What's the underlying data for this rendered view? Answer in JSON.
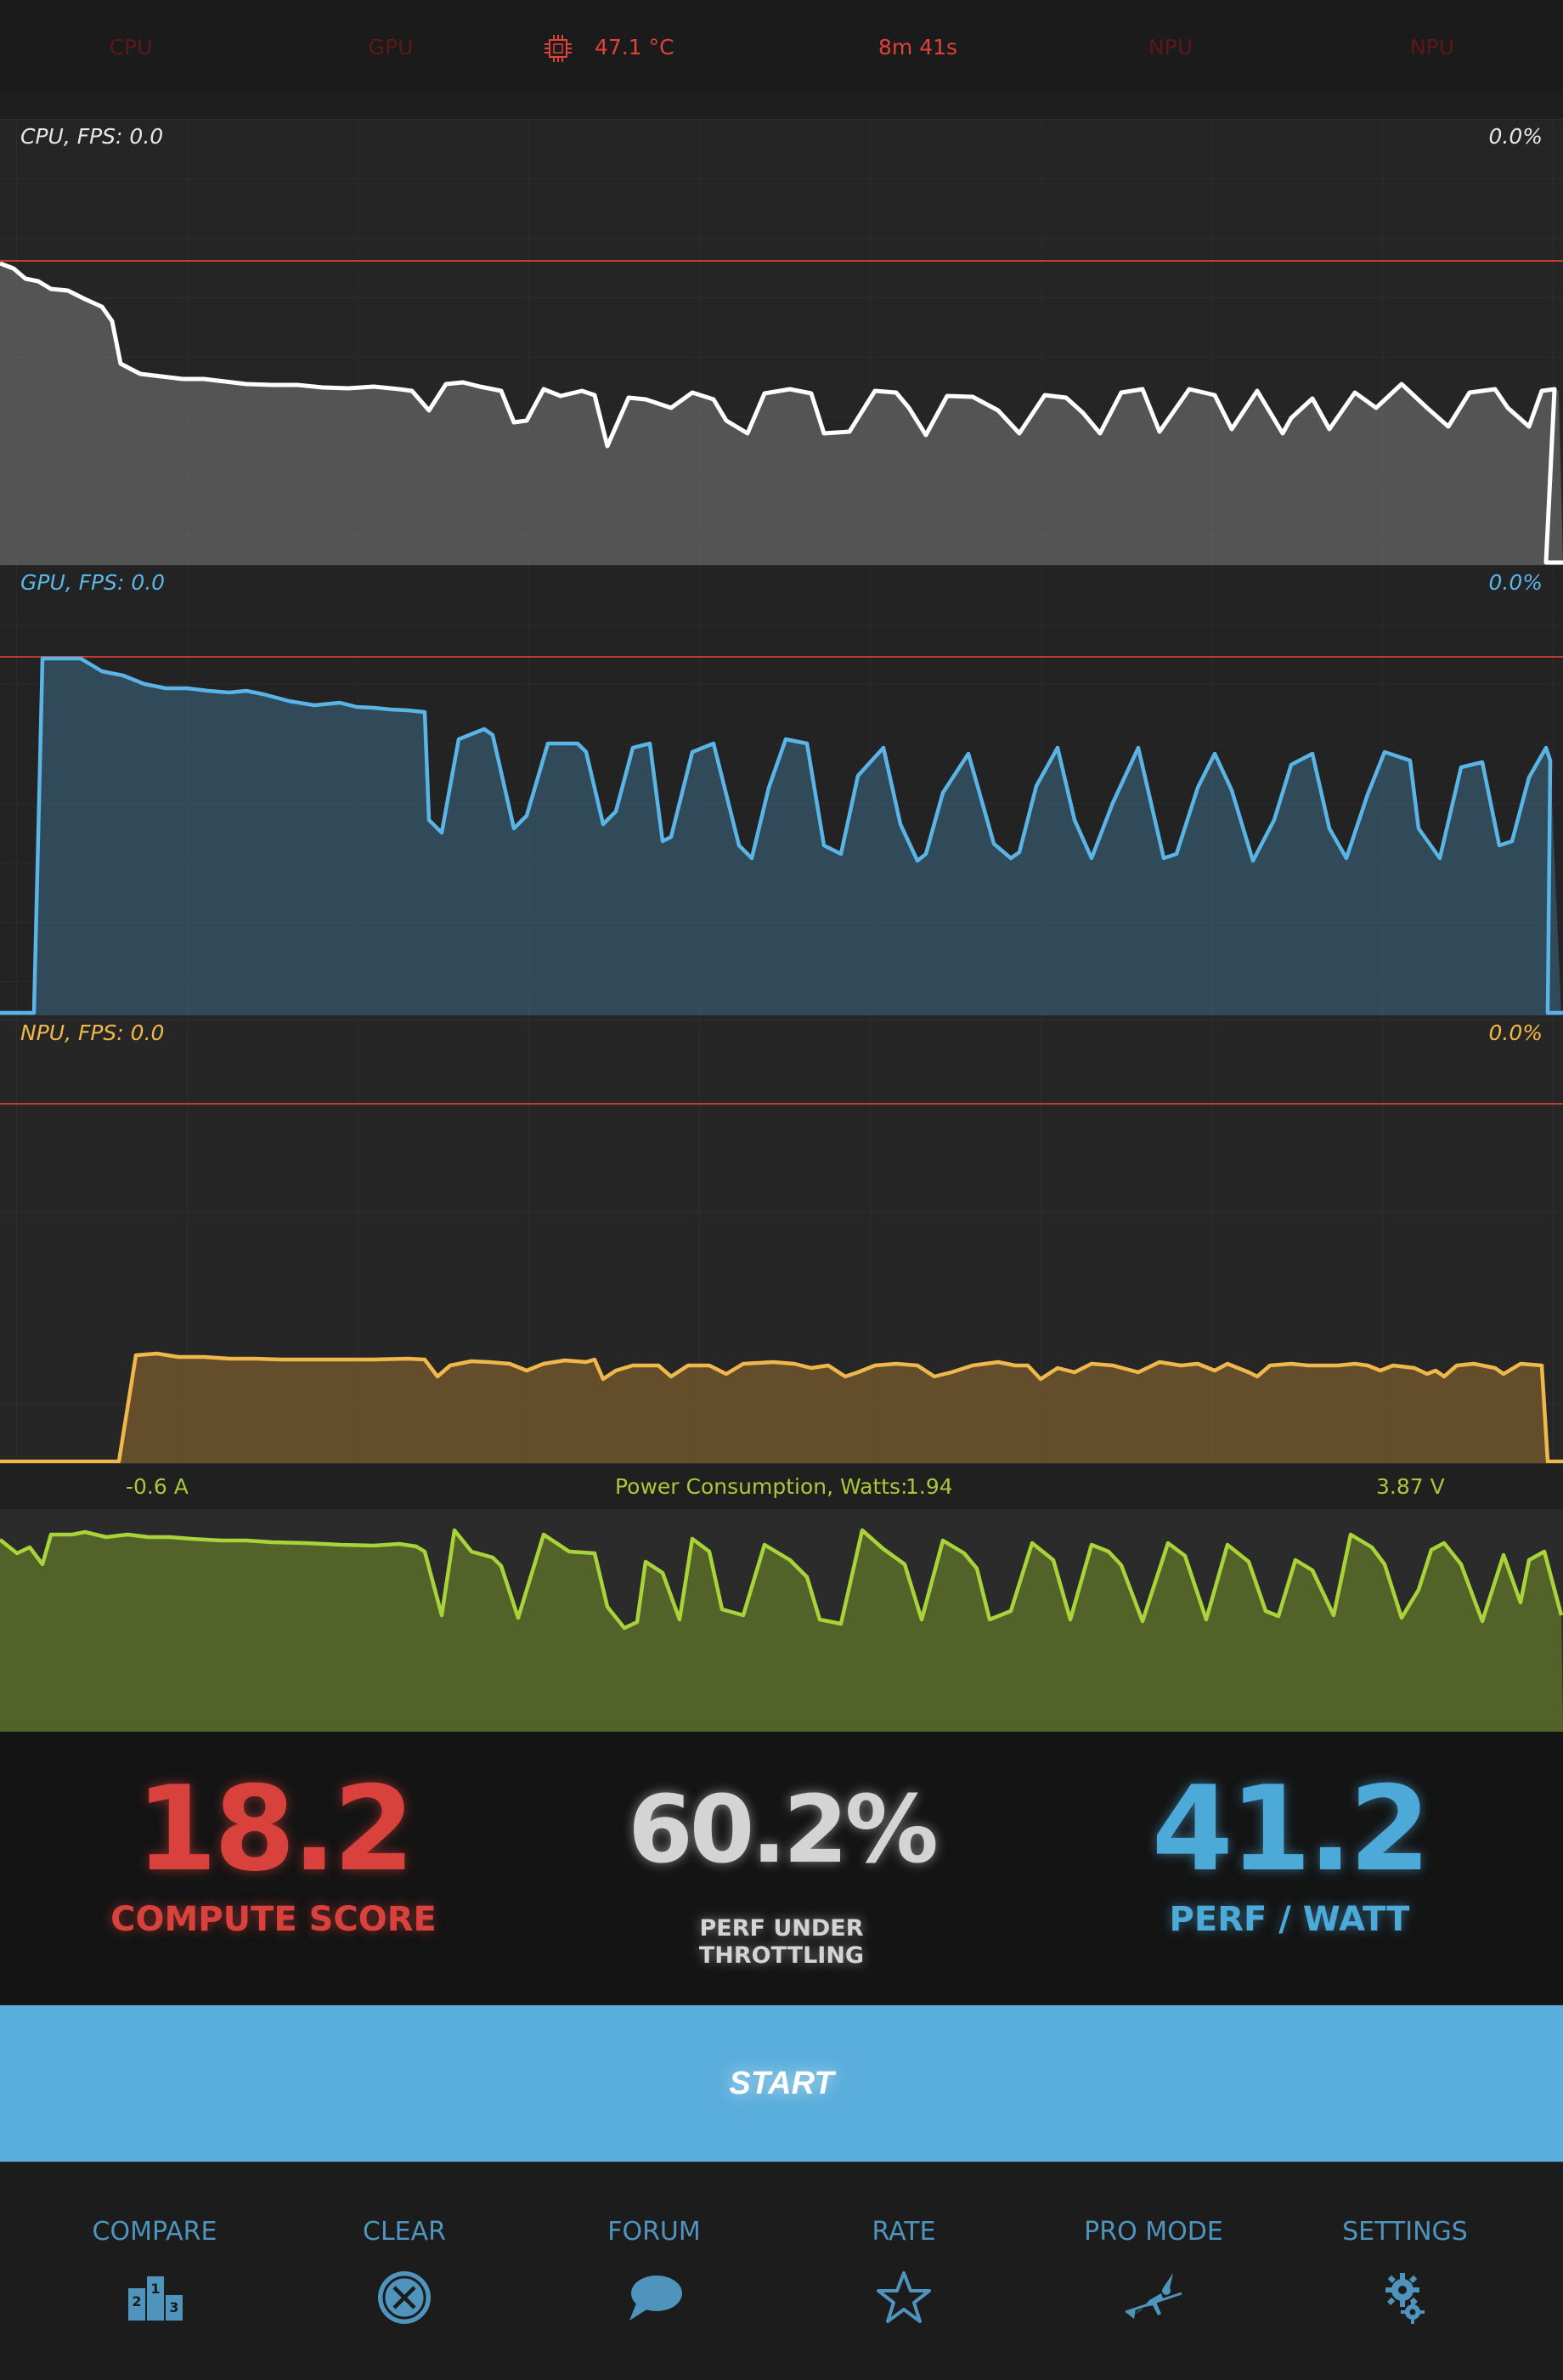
{
  "header": {
    "tabs": [
      {
        "label": "CPU",
        "active": false
      },
      {
        "label": "GPU",
        "active": false
      },
      {
        "label": "NPU",
        "active": false
      },
      {
        "label": "NPU",
        "active": false
      }
    ],
    "temperature": "47.1 °C",
    "elapsed": "8m 41s",
    "icons": {
      "temperature": "chip-icon"
    }
  },
  "panels": {
    "cpu": {
      "label": "CPU, FPS:  0.0",
      "value": "0.0%",
      "color": "#ffffff"
    },
    "gpu": {
      "label": "GPU, FPS:  0.0",
      "value": "0.0%",
      "color": "#5ab4e5"
    },
    "npu": {
      "label": "NPU, FPS:  0.0",
      "value": "0.0%",
      "color": "#f0b84a"
    }
  },
  "power": {
    "current": "-0.6 A",
    "label": "Power Consumption, Watts:",
    "watts": "1.94",
    "voltage": "3.87 V",
    "color": "#a8d43a"
  },
  "scores": {
    "compute": {
      "value": "18.2",
      "label": "COMPUTE SCORE",
      "color": "#d9413c"
    },
    "throttling": {
      "value": "60.2%",
      "label_line1": "PERF UNDER",
      "label_line2": "THROTTLING",
      "color": "#d4d4d4"
    },
    "perf_watt": {
      "value": "41.2",
      "label": "PERF / WATT",
      "color": "#4da9d8"
    }
  },
  "start_button": {
    "label": "START"
  },
  "nav": [
    {
      "label": "COMPARE",
      "icon": "podium-icon"
    },
    {
      "label": "CLEAR",
      "icon": "clear-icon"
    },
    {
      "label": "FORUM",
      "icon": "speech-bubble-icon"
    },
    {
      "label": "RATE",
      "icon": "star-icon"
    },
    {
      "label": "PRO MODE",
      "icon": "witch-icon"
    },
    {
      "label": "SETTINGS",
      "icon": "gear-icon"
    }
  ]
}
